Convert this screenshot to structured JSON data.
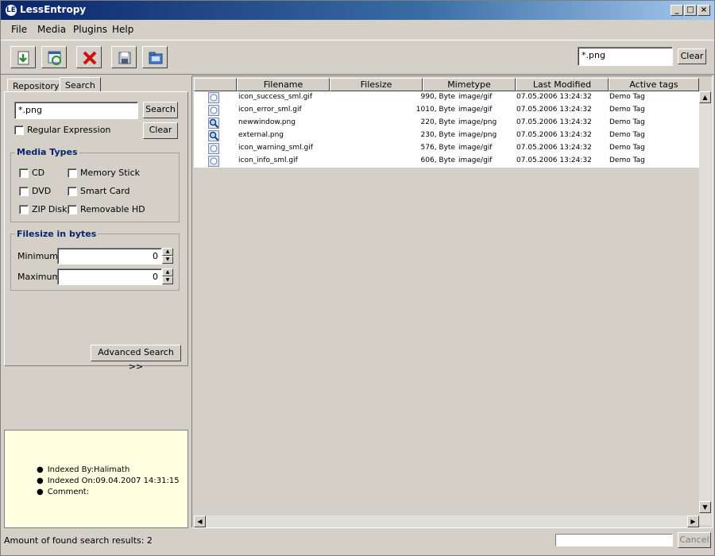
{
  "window": {
    "title": "LessEntropy",
    "icon": "app-logo-icon"
  },
  "menu": [
    "File",
    "Media",
    "Plugins",
    "Help"
  ],
  "toolbar": {
    "tools": [
      "import-icon",
      "refresh-icon",
      "delete-icon",
      "save-icon",
      "folder-icon"
    ],
    "search_value": "*.png",
    "clear_label": "Clear"
  },
  "left": {
    "tabs": [
      "Repository",
      "Search"
    ],
    "search_value": "*.png",
    "search_button": "Search",
    "regex_label": "Regular Expression",
    "clear_button": "Clear",
    "media_types_title": "Media Types",
    "media_types": [
      "CD",
      "Memory Stick",
      "DVD",
      "Smart Card",
      "ZIP Disk",
      "Removable HD"
    ],
    "filesize_title": "Filesize in bytes",
    "min_label": "Minimum",
    "min_value": "0",
    "max_label": "Maximum",
    "max_value": "0",
    "advanced_button": "Advanced Search >>"
  },
  "info": {
    "lines": [
      "Indexed By:Halimath",
      "Indexed On:09.04.2007 14:31:15",
      "Comment:"
    ]
  },
  "table": {
    "columns": [
      "Filename",
      "Filesize",
      "Mimetype",
      "Last Modified",
      "Active tags"
    ],
    "rows": [
      {
        "icon": "image-file-icon",
        "filename": "icon_success_sml.gif",
        "filesize": "990, Byte",
        "mimetype": "image/gif",
        "modified": "07.05.2006 13:24:32",
        "tags": "Demo Tag"
      },
      {
        "icon": "image-file-icon",
        "filename": "icon_error_sml.gif",
        "filesize": "1010, Byte",
        "mimetype": "image/gif",
        "modified": "07.05.2006 13:24:32",
        "tags": "Demo Tag"
      },
      {
        "icon": "magnifier-file-icon",
        "filename": "newwindow.png",
        "filesize": "220, Byte",
        "mimetype": "image/png",
        "modified": "07.05.2006 13:24:32",
        "tags": "Demo Tag"
      },
      {
        "icon": "magnifier-file-icon",
        "filename": "external.png",
        "filesize": "230, Byte",
        "mimetype": "image/png",
        "modified": "07.05.2006 13:24:32",
        "tags": "Demo Tag"
      },
      {
        "icon": "image-file-icon",
        "filename": "icon_warning_sml.gif",
        "filesize": "576, Byte",
        "mimetype": "image/gif",
        "modified": "07.05.2006 13:24:32",
        "tags": "Demo Tag"
      },
      {
        "icon": "image-file-icon",
        "filename": "icon_info_sml.gif",
        "filesize": "606, Byte",
        "mimetype": "image/gif",
        "modified": "07.05.2006 13:24:32",
        "tags": "Demo Tag"
      }
    ]
  },
  "status": {
    "text": "Amount of found search results: 2",
    "cancel_label": "Cancel"
  }
}
